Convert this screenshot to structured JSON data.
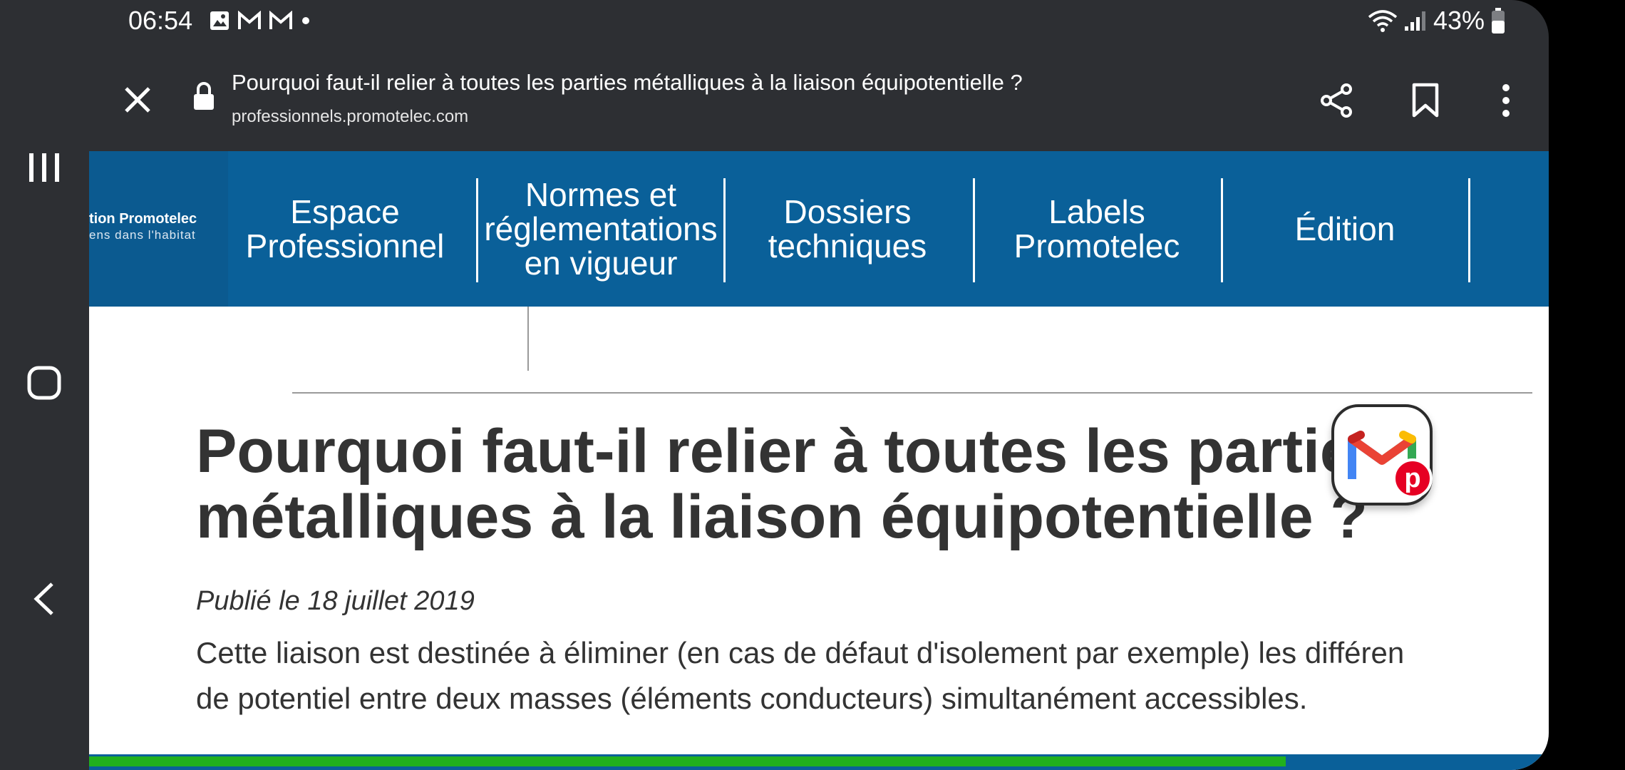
{
  "status_bar": {
    "time": "06:54",
    "battery": "43%",
    "notification_icons": [
      "image-icon",
      "gmail-icon",
      "gmail-icon",
      "dot-icon"
    ]
  },
  "browser": {
    "page_title": "Pourquoi faut-il relier à toutes les parties métalliques à la liaison équipotentielle ?",
    "domain": "professionnels.promotelec.com"
  },
  "site_nav": {
    "logo_line1": "tion Promotelec",
    "logo_line2": "ens dans l'habitat",
    "items": [
      {
        "label": "Espace Professionnel"
      },
      {
        "label": "Normes et réglementations en vigueur"
      },
      {
        "label": "Dossiers techniques"
      },
      {
        "label": "Labels Promotelec"
      },
      {
        "label": "Édition"
      }
    ]
  },
  "article": {
    "title": "Pourquoi faut-il relier à toutes les parties métalliques à la liaison équipotentielle ?",
    "date": "Publié le 18 juillet 2019",
    "body_line1": "Cette liaison est destinée à éliminer (en cas de défaut d'isolement par exemple) les différen",
    "body_line2": "de potentiel entre deux masses (éléments conducteurs) simultanément accessibles."
  },
  "page_load_progress": 0.82,
  "colors": {
    "browser_chrome": "#2d2f33",
    "site_nav": "#0a6099",
    "progress": "#21b01e",
    "text": "#333333"
  }
}
